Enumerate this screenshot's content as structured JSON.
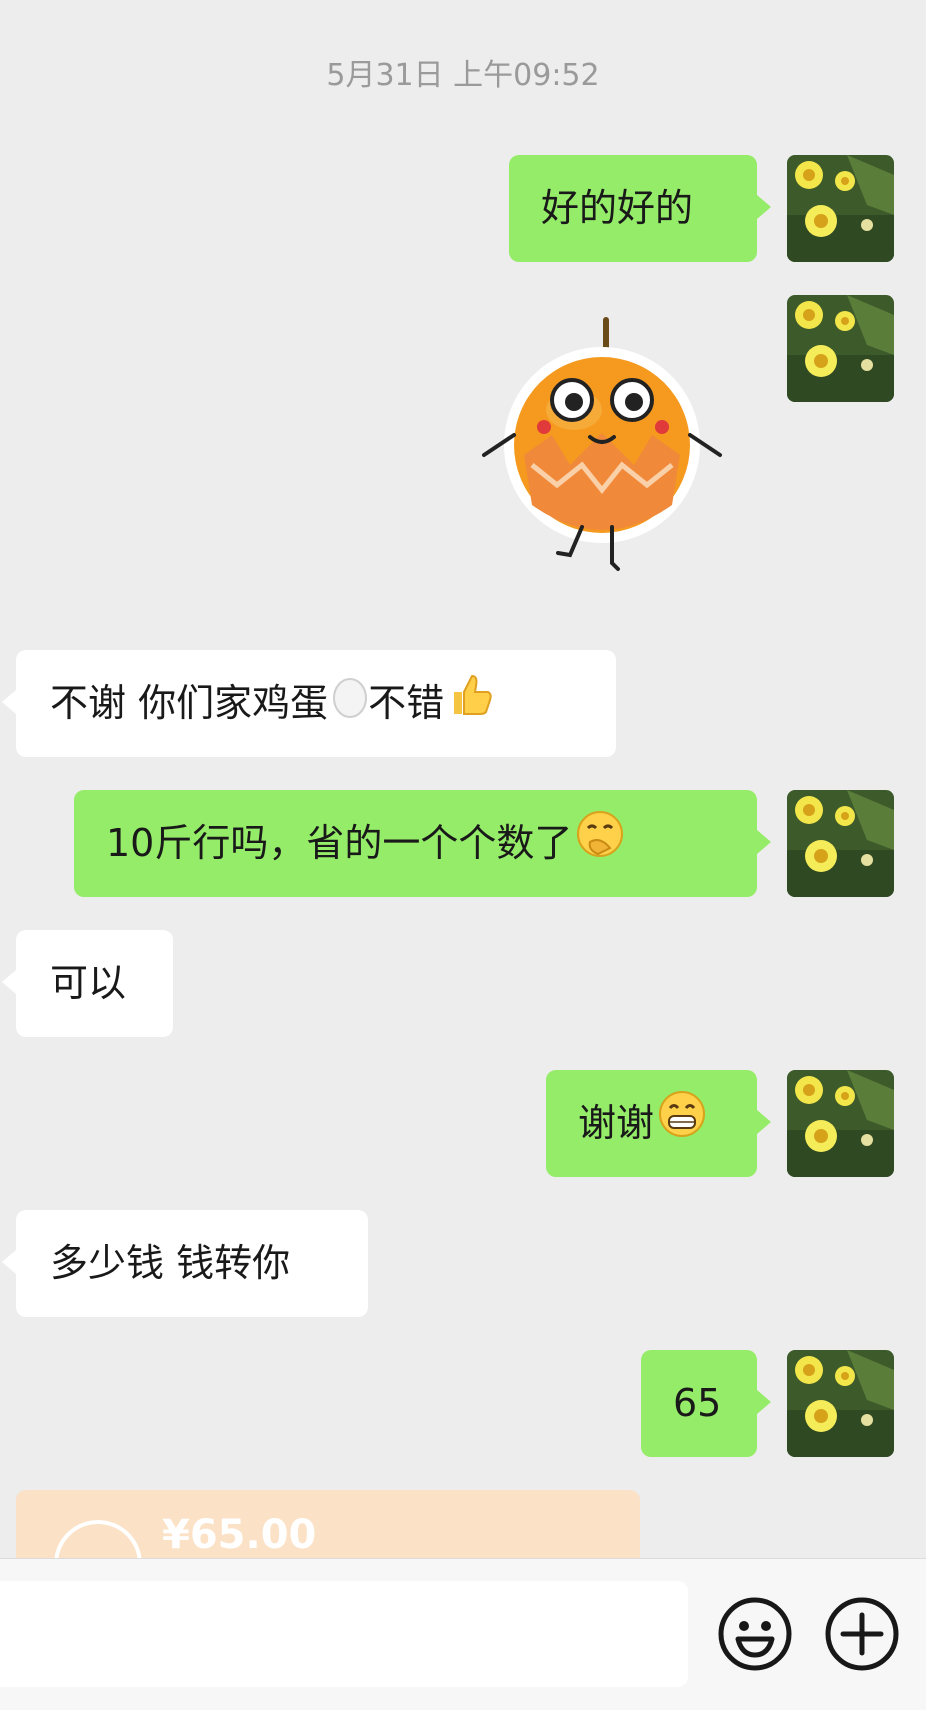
{
  "chat": {
    "timestamp": "5月31日 上午09:52",
    "messages": [
      {
        "side": "me",
        "text": "好的好的"
      },
      {
        "side": "me",
        "type": "sticker",
        "sticker_icon": "orange-character-sticker"
      },
      {
        "side": "them",
        "text": "不谢 你们家鸡蛋",
        "trail_emoji": "egg-icon",
        "text2": "不错",
        "trail_emoji2": "thumbs-up-icon"
      },
      {
        "side": "me",
        "text": "10斤行吗，省的一个个数了",
        "trail_emoji": "face-hand-over-mouth-icon"
      },
      {
        "side": "them",
        "text": "可以"
      },
      {
        "side": "me",
        "text": "谢谢",
        "trail_emoji": "grinning-face-icon"
      },
      {
        "side": "them",
        "text": "多少钱 钱转你"
      },
      {
        "side": "me",
        "text": "65"
      },
      {
        "side": "them",
        "type": "transfer",
        "amount": "¥65.00"
      }
    ]
  },
  "input_bar": {
    "placeholder": "",
    "emoji_button_icon": "smiley-face-icon",
    "more_button_icon": "plus-circle-icon"
  },
  "colors": {
    "background": "#ededed",
    "my_bubble": "#95ec69",
    "their_bubble": "#ffffff",
    "transfer_card": "#fbe1c6"
  }
}
